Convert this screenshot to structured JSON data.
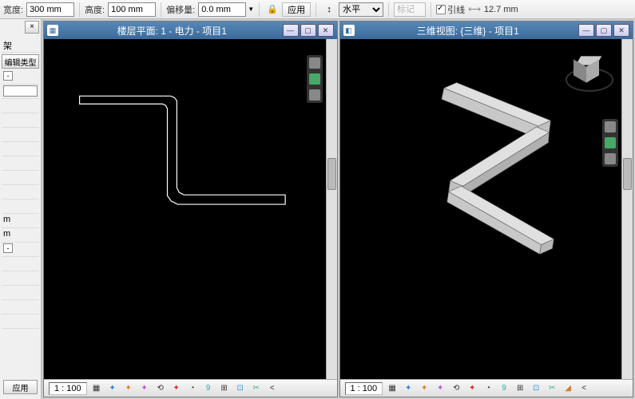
{
  "toolbar": {
    "width_label": "宽度:",
    "width_value": "300 mm",
    "height_label": "高度:",
    "height_value": "100 mm",
    "offset_label": "偏移量:",
    "offset_value": "0.0 mm",
    "apply_label": "应用",
    "align_label": "水平",
    "mark_label": "标记",
    "guides_label": "引线",
    "guides_value": "12.7 mm"
  },
  "sidebar": {
    "close": "×",
    "item1": "架",
    "edit_label": "编辑类型",
    "unit": "m",
    "apply_label": "应用"
  },
  "views": {
    "left": {
      "title": "楼层平面: 1 - 电力 - 项目1"
    },
    "right": {
      "title": "三维视图: {三维} - 项目1"
    }
  },
  "status": {
    "scale": "1 : 100"
  }
}
